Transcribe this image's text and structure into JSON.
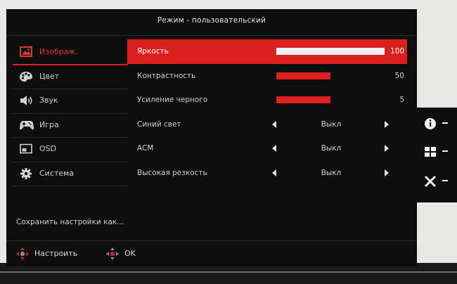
{
  "osd": {
    "title": "Режим - пользовательский",
    "sidebar": [
      {
        "label": "Изображ.",
        "icon": "image-icon",
        "active": true
      },
      {
        "label": "Цвет",
        "icon": "palette-icon",
        "active": false
      },
      {
        "label": "Звук",
        "icon": "speaker-icon",
        "active": false
      },
      {
        "label": "Игра",
        "icon": "gamepad-icon",
        "active": false
      },
      {
        "label": "OSD",
        "icon": "osd-window-icon",
        "active": false
      },
      {
        "label": "Система",
        "icon": "gear-icon",
        "active": false
      }
    ],
    "save_label": "Сохранить настройки как...",
    "rows": [
      {
        "name": "Яркость",
        "type": "slider",
        "value": "100",
        "level": 1.0,
        "active": true
      },
      {
        "name": "Контрастность",
        "type": "slider",
        "value": "50",
        "level": 0.5,
        "active": false
      },
      {
        "name": "Усиление черного",
        "type": "slider",
        "value": "5",
        "level": 0.5,
        "active": false
      },
      {
        "name": "Синий свет",
        "type": "option",
        "value": "Выкл",
        "active": false
      },
      {
        "name": "ACM",
        "type": "option",
        "value": "Выкл",
        "active": false
      },
      {
        "name": "Высокая резкость",
        "type": "option",
        "value": "Выкл",
        "active": false
      }
    ],
    "footer": {
      "adjust_label": "Настроить",
      "ok_label": "OK"
    },
    "colors": {
      "accent": "#dc1f1f",
      "background": "#0e0e0e"
    }
  },
  "side_keys": [
    {
      "icon": "info-icon"
    },
    {
      "icon": "menu-grid-icon"
    },
    {
      "icon": "close-icon"
    }
  ]
}
